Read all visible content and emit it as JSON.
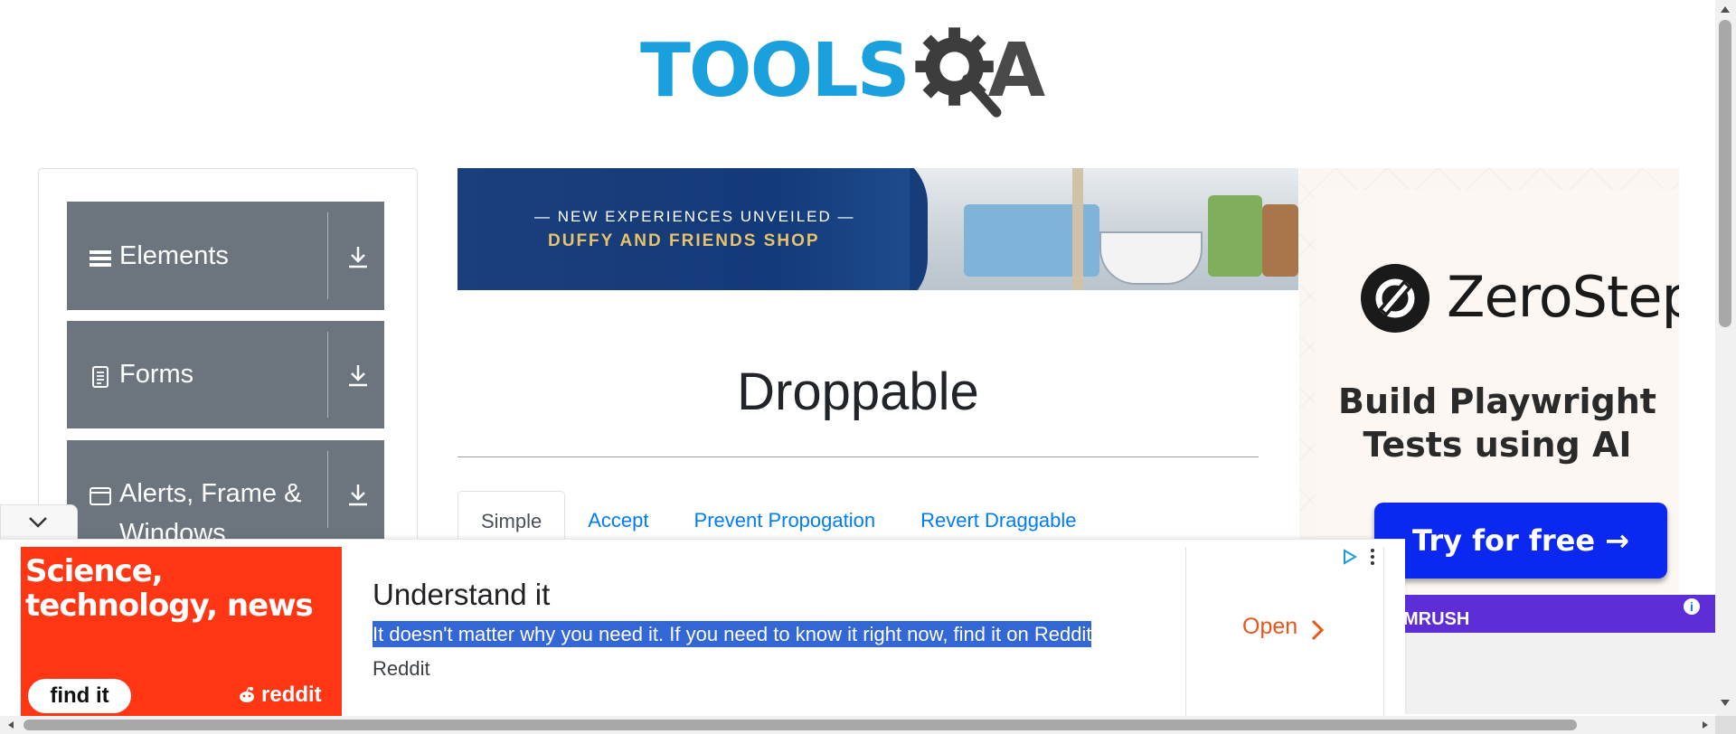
{
  "logo": {
    "text_tools": "TOOLS",
    "text_a": "A",
    "colors": {
      "tools": "#1aa0dc",
      "qa": "#4a4a4a"
    }
  },
  "sidebar": {
    "groups": [
      {
        "label": "Elements",
        "icon": "hamburger-icon"
      },
      {
        "label": "Forms",
        "icon": "document-icon"
      },
      {
        "label": "Alerts, Frame &",
        "label_line2": "Windows",
        "icon": "window-icon"
      }
    ],
    "download_icon": "download-icon",
    "bg_color": "#6c757d"
  },
  "banner_ad": {
    "line1": "— NEW EXPERIENCES UNVEILED —",
    "line2": "DUFFY AND FRIENDS SHOP"
  },
  "main": {
    "title": "Droppable",
    "tabs": [
      {
        "label": "Simple",
        "active": true
      },
      {
        "label": "Accept",
        "active": false
      },
      {
        "label": "Prevent Propogation",
        "active": false
      },
      {
        "label": "Revert Draggable",
        "active": false
      }
    ]
  },
  "right_ad": {
    "brand": "ZeroStep",
    "tagline_line1": "Build Playwright",
    "tagline_line2": "Tests using AI",
    "button": "Try for free →",
    "button_color": "#0b28f0"
  },
  "small_ad": {
    "text": "MRUSH",
    "info": "i"
  },
  "bottom_ad": {
    "image_headline_line1": "Science,",
    "image_headline_line2": "technology, news",
    "image_button": "find it",
    "image_brand": "reddit",
    "heading": "Understand it",
    "description": "It doesn't matter why you need it. If you need to know it right now, find it on Reddit",
    "advertiser": "Reddit",
    "cta": "Open",
    "accent_color": "#ff3614"
  }
}
